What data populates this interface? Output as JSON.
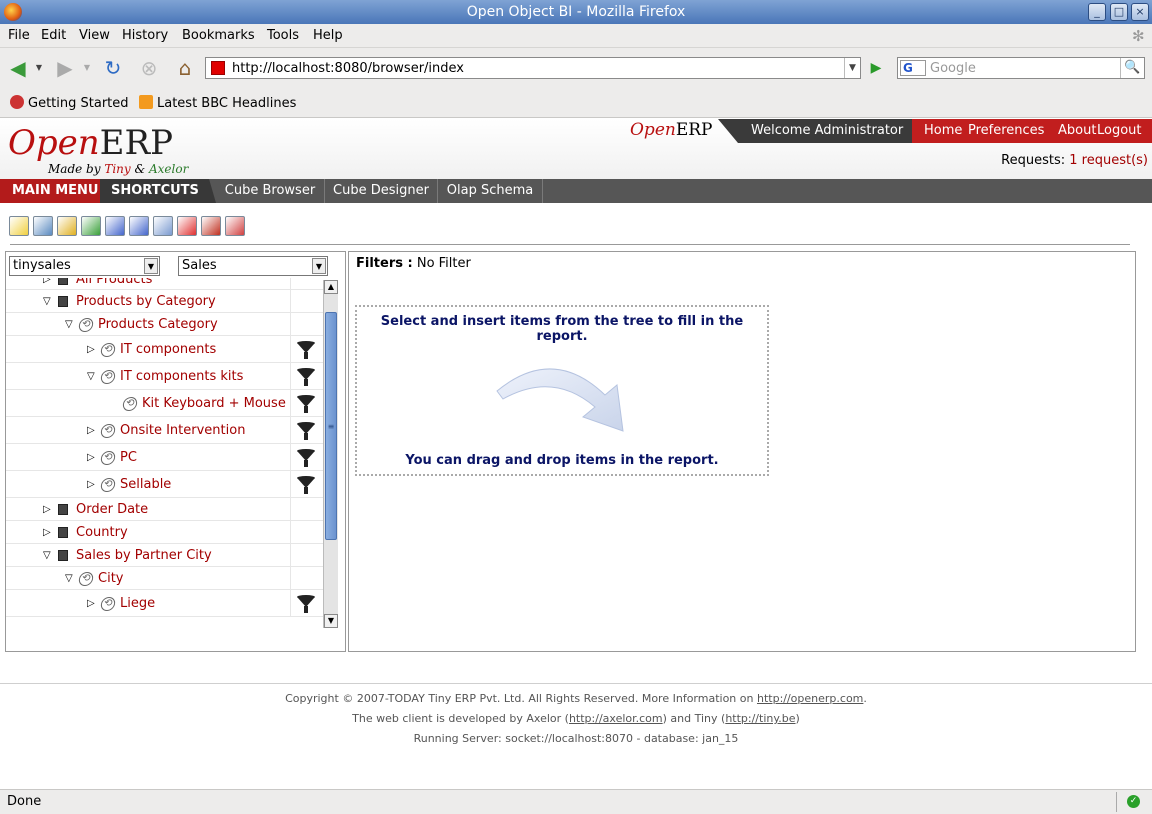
{
  "window": {
    "title": "Open Object BI - Mozilla Firefox"
  },
  "menubar": {
    "items": [
      "File",
      "Edit",
      "View",
      "History",
      "Bookmarks",
      "Tools",
      "Help"
    ]
  },
  "navbar": {
    "url": "http://localhost:8080/browser/index",
    "search_placeholder": "Google",
    "search_engine": "G"
  },
  "bookmarks": {
    "items": [
      "Getting Started",
      "Latest BBC Headlines"
    ]
  },
  "erp": {
    "logo_open": "Open",
    "logo_erp": "ERP",
    "logo_made_prefix": "Made by ",
    "logo_made_tiny": "Tiny",
    "logo_made_amp": " & ",
    "logo_made_axelor": "Axelor",
    "mini_logo_open": "Open",
    "mini_logo_erp": "ERP",
    "welcome": "Welcome Administrator",
    "top_links": [
      "Home",
      "Preferences",
      "About",
      "Logout"
    ],
    "requests_label": "Requests:",
    "requests_link": "1 request(s)"
  },
  "menustrip": {
    "main_menu": "MAIN MENU",
    "shortcuts": "SHORTCUTS",
    "tabs": [
      "Cube Browser",
      "Cube Designer",
      "Olap Schema"
    ]
  },
  "toolbar": {
    "icon_colors": [
      "#f0d040",
      "#5a8ac0",
      "#e0b020",
      "#3aa03a",
      "#4466cc",
      "#4466cc",
      "#7a9ad0",
      "#e03030",
      "#c03020",
      "#d04040"
    ]
  },
  "left": {
    "schema_select": "tinysales",
    "cube_select": "Sales",
    "tree": [
      {
        "label": "All Products",
        "expand": "right",
        "icon": "cube",
        "level": 0
      },
      {
        "label": "Products by Category",
        "expand": "down",
        "icon": "cube",
        "level": 0
      },
      {
        "label": "Products Category",
        "expand": "down",
        "icon": "level",
        "level": 1
      },
      {
        "label": "IT components",
        "expand": "right",
        "icon": "level",
        "level": 2,
        "filter": true
      },
      {
        "label": "IT components kits",
        "expand": "down",
        "icon": "level",
        "level": 2,
        "filter": true
      },
      {
        "label": "Kit Keyboard + Mouse",
        "expand": "",
        "icon": "level",
        "level": 3,
        "filter": true
      },
      {
        "label": "Onsite Intervention",
        "expand": "right",
        "icon": "level",
        "level": 2,
        "filter": true
      },
      {
        "label": "PC",
        "expand": "right",
        "icon": "level",
        "level": 2,
        "filter": true
      },
      {
        "label": "Sellable",
        "expand": "right",
        "icon": "level",
        "level": 2,
        "filter": true
      },
      {
        "label": "Order Date",
        "expand": "right",
        "icon": "cube",
        "level": 0
      },
      {
        "label": "Country",
        "expand": "right",
        "icon": "cube",
        "level": 0
      },
      {
        "label": "Sales by Partner City",
        "expand": "down",
        "icon": "cube",
        "level": 0
      },
      {
        "label": "City",
        "expand": "down",
        "icon": "level",
        "level": 1
      },
      {
        "label": "Liege",
        "expand": "right",
        "icon": "level",
        "level": 2,
        "filter": true
      }
    ]
  },
  "right": {
    "filters_label": "Filters :",
    "filters_value": "No Filter",
    "dropzone_line1": "Select and insert items from the tree to fill in the",
    "dropzone_line2": "report.",
    "dropzone_drag": "You can drag and drop items in the report."
  },
  "footer": {
    "line1_text": "Copyright © 2007-TODAY Tiny ERP Pvt. Ltd. All Rights Reserved. More Information on ",
    "line1_link": "http://openerp.com",
    "line1_end": ".",
    "line2_text": "The web client is developed by Axelor (",
    "line2_link1": "http://axelor.com",
    "line2_mid": ") and Tiny (",
    "line2_link2": "http://tiny.be",
    "line2_end": ")",
    "line3": "Running Server: socket://localhost:8070 - database: jan_15"
  },
  "status": {
    "text": "Done"
  }
}
